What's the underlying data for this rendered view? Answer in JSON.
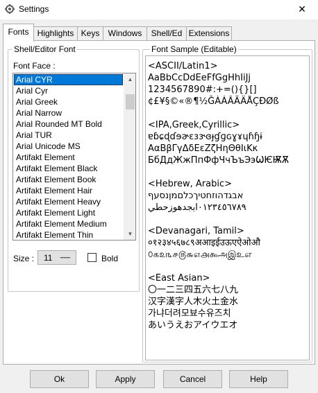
{
  "window": {
    "title": "Settings",
    "close_glyph": "✕",
    "app_icon": "gear-icon"
  },
  "tabs": [
    {
      "label": "Fonts",
      "active": true
    },
    {
      "label": "Highlights",
      "active": false
    },
    {
      "label": "Keys",
      "active": false
    },
    {
      "label": "Windows",
      "active": false
    },
    {
      "label": "Shell/Ed",
      "active": false
    },
    {
      "label": "Extensions",
      "active": false
    }
  ],
  "shell_editor_font": {
    "legend": "Shell/Editor Font",
    "font_face_label": "Font Face :",
    "fonts": [
      "Arial CYR",
      "Arial Cyr",
      "Arial Greek",
      "Arial Narrow",
      "Arial Rounded MT Bold",
      "Arial TUR",
      "Arial Unicode MS",
      "Artifakt Element",
      "Artifakt Element Black",
      "Artifakt Element Book",
      "Artifakt Element Hair",
      "Artifakt Element Heavy",
      "Artifakt Element Light",
      "Artifakt Element Medium",
      "Artifakt Element Thin"
    ],
    "selected_font": "Arial CYR",
    "size_label": "Size :",
    "size_value": "11",
    "bold_label": "Bold",
    "bold_checked": false
  },
  "font_sample": {
    "legend": "Font Sample (Editable)",
    "lines": [
      "<ASCII/Latin1>",
      "AaBbCcDdEeFfGgHhIiJj",
      "1234567890#:+=(){}[]",
      "¢£¥§©«®¶½ĞÀÁÂÃÄÅÇĐØß",
      "",
      "<IPA,Greek,Cyrillic>",
      "ɐɓɕɖɗɘɚɛɜɝɞɟɠɡɢɣɤɥɦɧɨ",
      "ΑαΒβΓγΔδΕεΖζΗηΘθΙιΚκ",
      "БбДдЖжПпФфЧчЪъЭэѠѤѬѪ",
      "",
      "<Hebrew, Arabic>",
      "אבגדהוזחטיךכלםמןנסעף",
      "٠١٢٣٤٥٦٧٨٩ابجدهوزحطي",
      "",
      "<Devanagari, Tamil>",
      "०१२३४५६७८९अआइईउऊएऐओऔ",
      "௦௧௨௩௪௫௬௭௮௯அஇஉஎ",
      "",
      "<East Asian>",
      "〇一二三四五六七八九",
      "汉字漢字人木火土金水",
      "가냐더려모뵤수유즈치",
      "あいうえおアイウエオ"
    ]
  },
  "buttons": {
    "ok": "Ok",
    "apply": "Apply",
    "cancel": "Cancel",
    "help": "Help"
  }
}
